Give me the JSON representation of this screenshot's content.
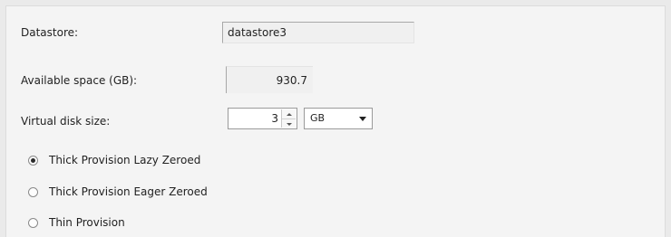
{
  "form": {
    "datastore": {
      "label": "Datastore:",
      "value": "datastore3"
    },
    "available_space": {
      "label": "Available space (GB):",
      "value": "930.7"
    },
    "virtual_disk_size": {
      "label": "Virtual disk size:",
      "value": "3",
      "unit_options_selected": "GB"
    },
    "provisioning": {
      "options": [
        {
          "label": "Thick Provision Lazy Zeroed",
          "checked": true
        },
        {
          "label": "Thick Provision Eager Zeroed",
          "checked": false
        },
        {
          "label": "Thin Provision",
          "checked": false
        }
      ]
    }
  },
  "icons": {
    "spin_up": "spin-up-icon",
    "spin_down": "spin-down-icon",
    "dropdown": "chevron-down-icon"
  }
}
